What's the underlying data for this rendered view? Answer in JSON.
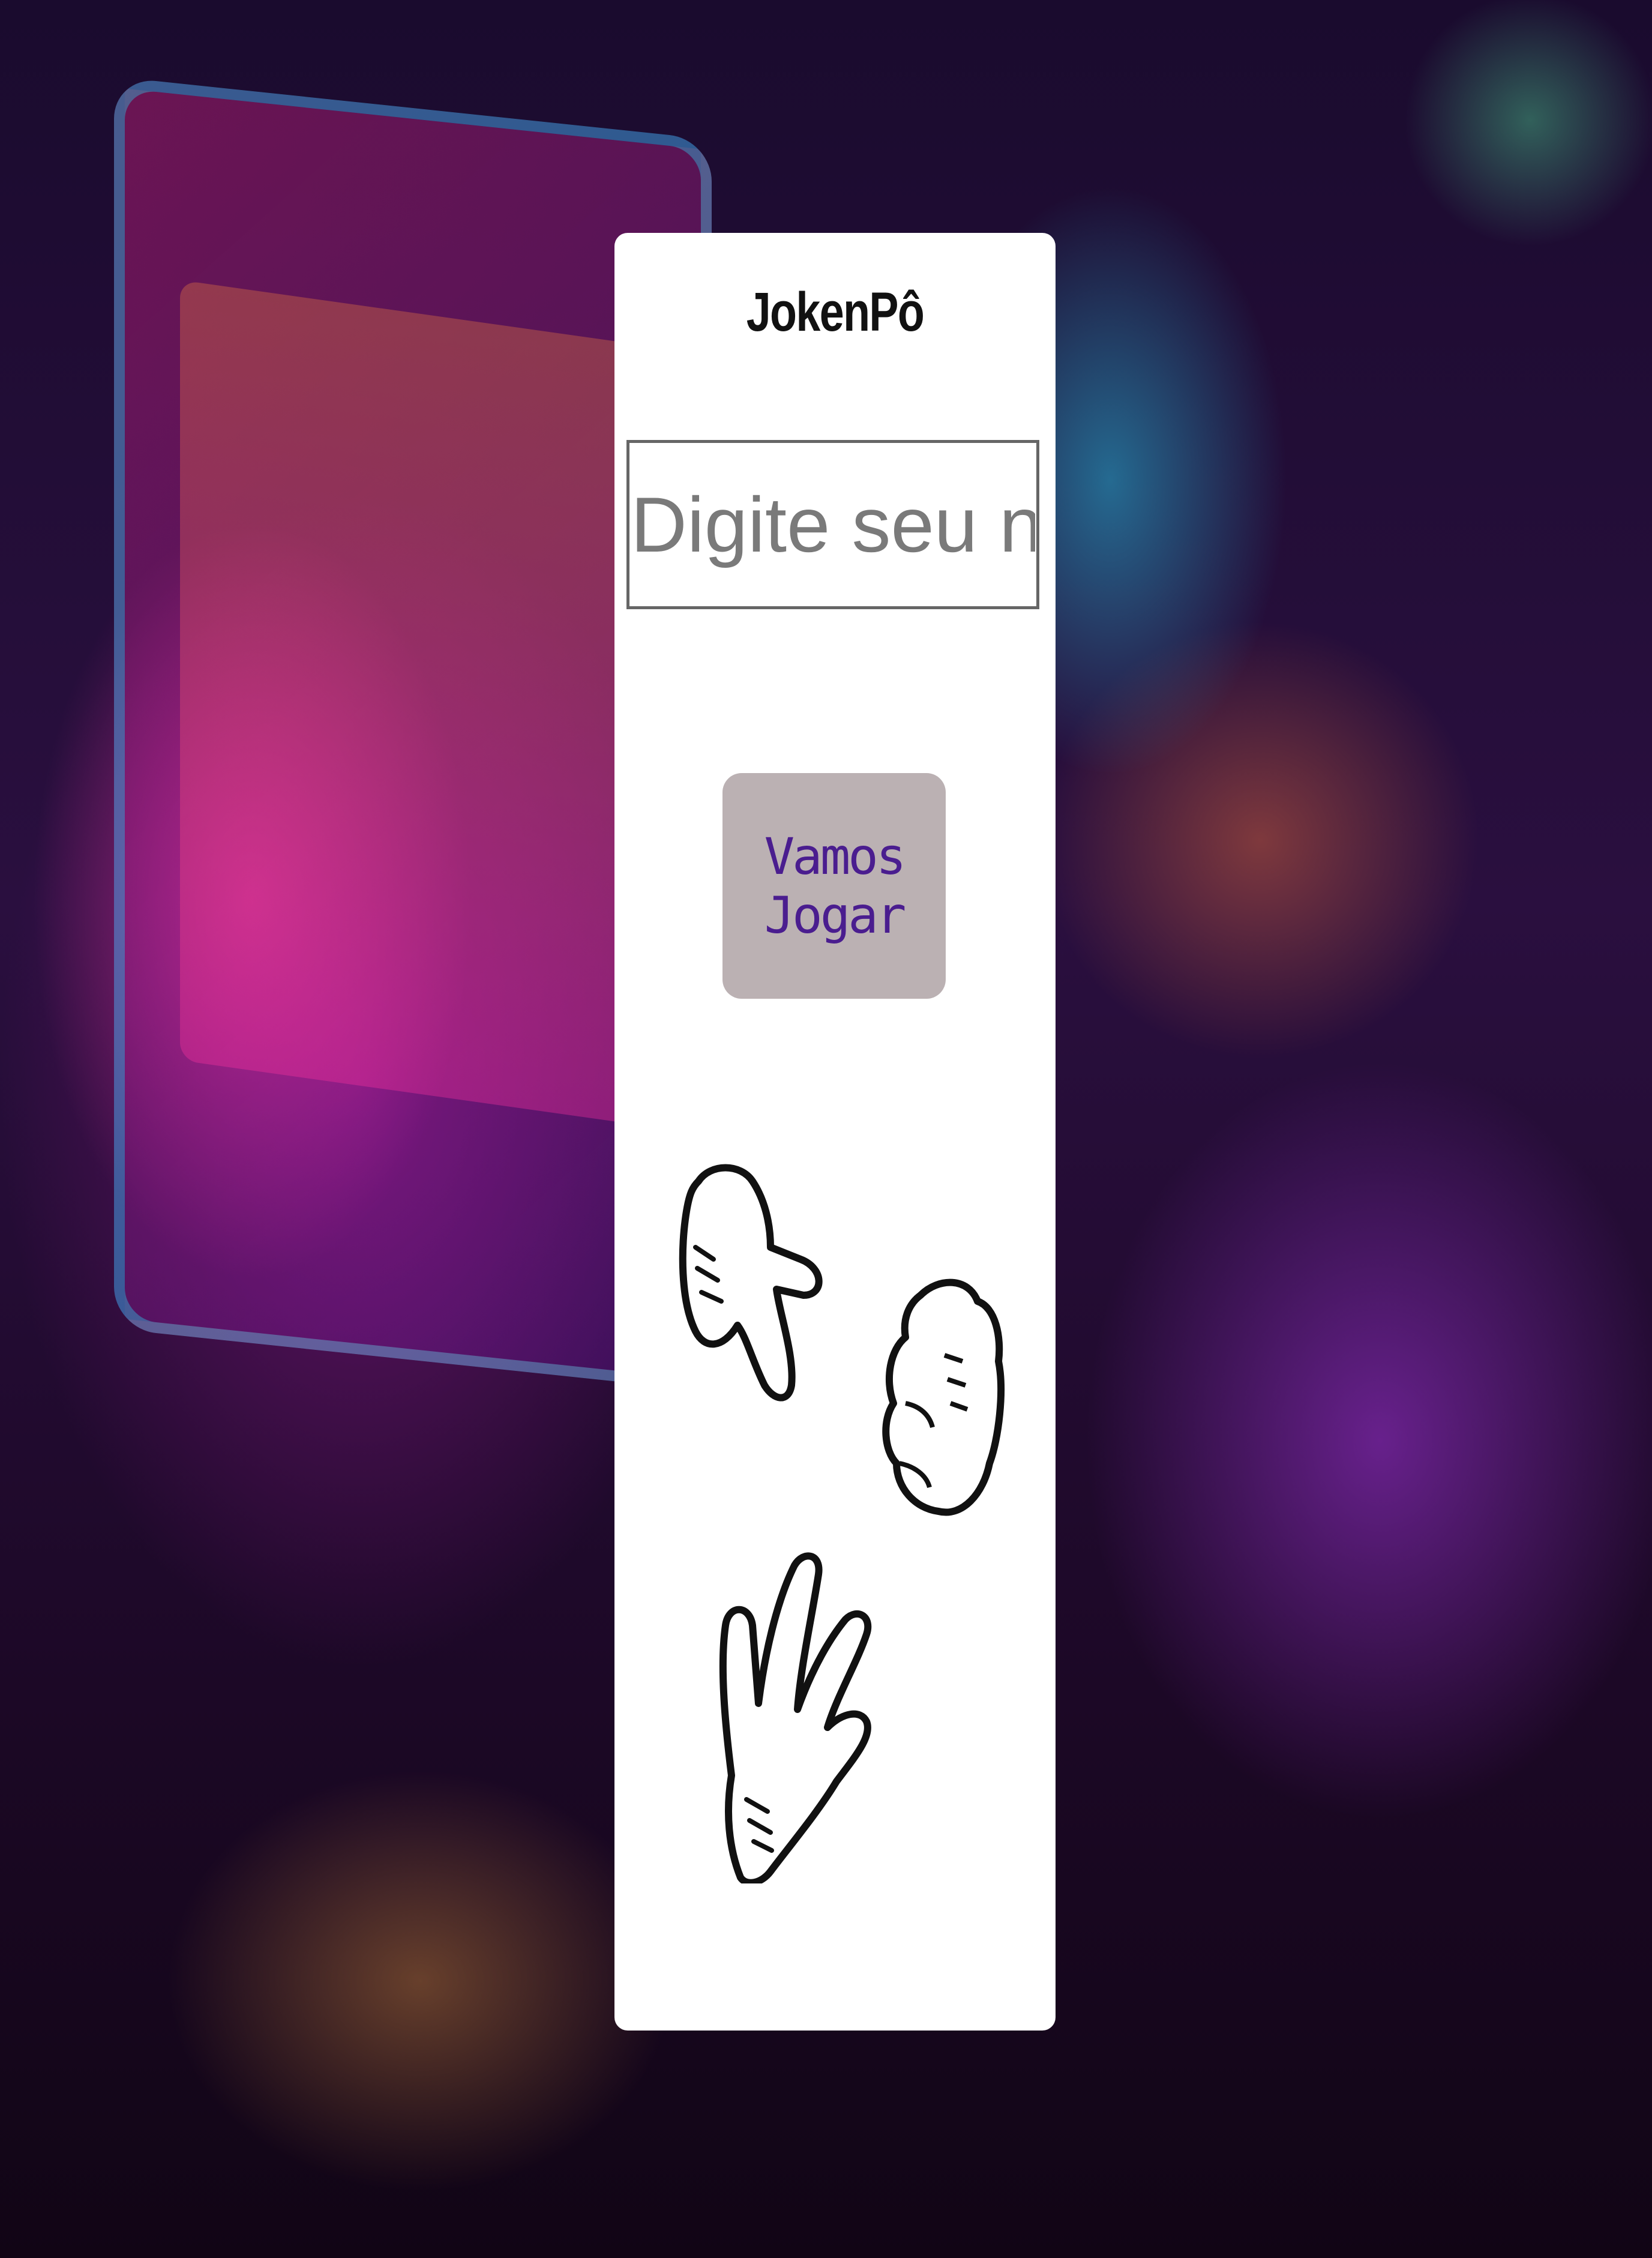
{
  "game": {
    "title": "JokenPô",
    "name_placeholder": "Digite seu nome",
    "play_label": "Vamos Jogar"
  },
  "choices": [
    {
      "icon": "scissors-hand-icon"
    },
    {
      "icon": "rock-fist-icon"
    },
    {
      "icon": "paper-hand-icon"
    }
  ]
}
